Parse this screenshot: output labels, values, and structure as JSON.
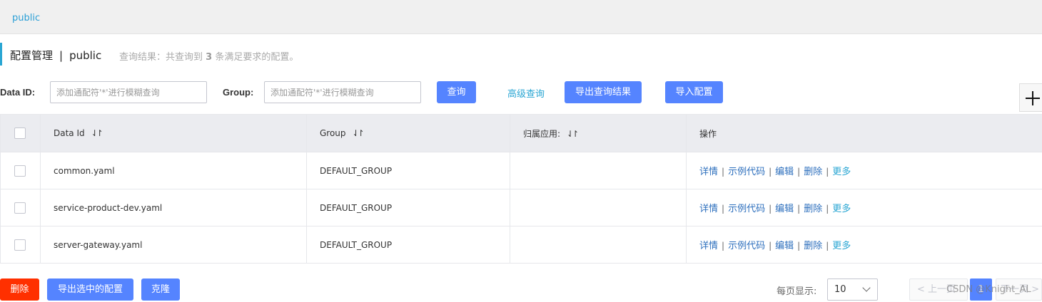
{
  "namespace_tab": "public",
  "header": {
    "title": "配置管理",
    "divider": "|",
    "namespace": "public",
    "summary_prefix": "查询结果：共查询到",
    "summary_count": "3",
    "summary_suffix": "条满足要求的配置。"
  },
  "filters": {
    "data_id_label": "Data ID:",
    "data_id_placeholder": "添加通配符'*'进行模糊查询",
    "data_id_value": "",
    "group_label": "Group:",
    "group_placeholder": "添加通配符'*'进行模糊查询",
    "group_value": "",
    "search_label": "查询",
    "advanced_label": "高级查询",
    "export_results_label": "导出查询结果",
    "import_label": "导入配置"
  },
  "table": {
    "columns": [
      "Data Id",
      "Group",
      "归属应用:",
      "操作"
    ],
    "sort_icon": "⇃↾",
    "rows": [
      {
        "data_id": "common.yaml",
        "group": "DEFAULT_GROUP",
        "app": ""
      },
      {
        "data_id": "service-product-dev.yaml",
        "group": "DEFAULT_GROUP",
        "app": ""
      },
      {
        "data_id": "server-gateway.yaml",
        "group": "DEFAULT_GROUP",
        "app": ""
      }
    ],
    "operations": {
      "detail": "详情",
      "sample_code": "示例代码",
      "edit": "编辑",
      "delete": "删除",
      "more": "更多",
      "separator": "|"
    }
  },
  "footer": {
    "delete_label": "删除",
    "export_selected_label": "导出选中的配置",
    "clone_label": "克隆",
    "page_size_label": "每页显示:",
    "page_size_value": "10",
    "prev_label": "< 上一页",
    "current_page": "1",
    "next_label": "下一页 >",
    "watermark": "CSDN @Knight_AL"
  },
  "colors": {
    "primary": "#5584ff",
    "danger": "#ff3000",
    "link": "#2d6fbd",
    "accent": "#2aa6d3"
  }
}
